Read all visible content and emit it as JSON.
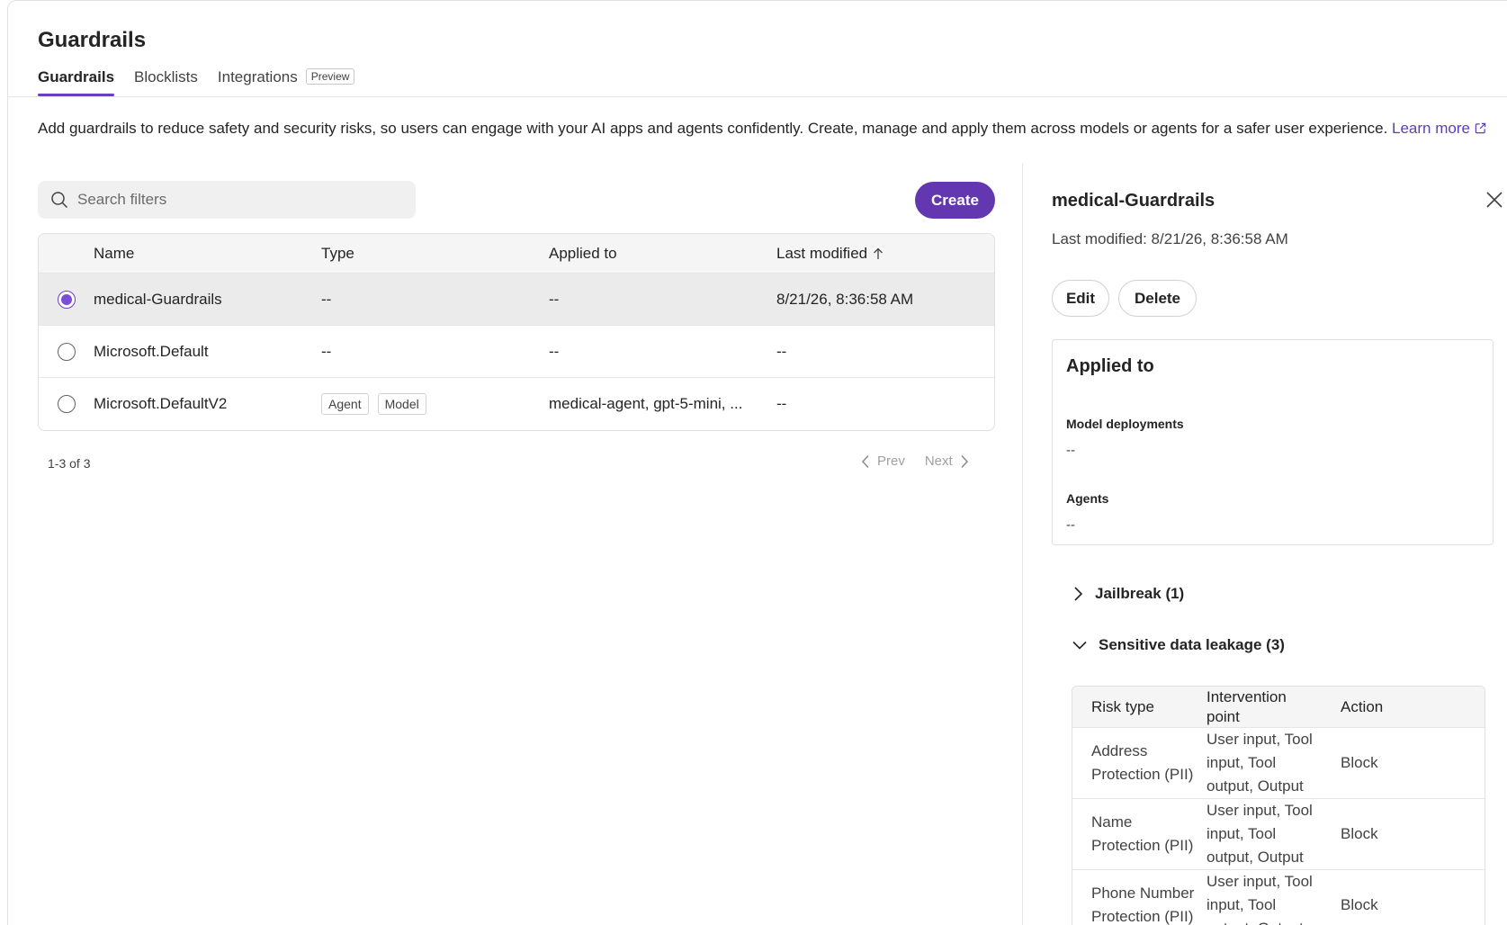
{
  "page": {
    "title": "Guardrails",
    "tabs": [
      {
        "label": "Guardrails"
      },
      {
        "label": "Blocklists"
      },
      {
        "label": "Integrations",
        "badge": "Preview"
      }
    ],
    "intro_text": "Add guardrails to reduce safety and security risks, so users can engage with your AI apps and agents confidently. Create, manage and apply them across models or agents for a safer user experience. ",
    "learn_more": "Learn more"
  },
  "toolbar": {
    "search_placeholder": "Search filters",
    "create_label": "Create"
  },
  "table": {
    "headers": {
      "name": "Name",
      "type": "Type",
      "applied": "Applied to",
      "modified": "Last modified"
    },
    "rows": [
      {
        "name": "medical-Guardrails",
        "type": "--",
        "applied": "--",
        "modified": "8/21/26, 8:36:58 AM",
        "selected": true
      },
      {
        "name": "Microsoft.Default",
        "type": "--",
        "applied": "--",
        "modified": "--",
        "selected": false
      },
      {
        "name": "Microsoft.DefaultV2",
        "tags": [
          "Agent",
          "Model"
        ],
        "applied": "medical-agent, gpt-5-mini, ...",
        "modified": "--",
        "selected": false
      }
    ]
  },
  "pagination": {
    "count": "1-3 of 3",
    "prev": "Prev",
    "next": "Next"
  },
  "panel": {
    "title": "medical-Guardrails",
    "last_modified": "Last modified: 8/21/26, 8:36:58 AM",
    "edit_label": "Edit",
    "delete_label": "Delete",
    "applied": {
      "title": "Applied to",
      "model_label": "Model deployments",
      "model_value": "--",
      "agents_label": "Agents",
      "agents_value": "--"
    },
    "sections": [
      {
        "label": "Jailbreak (1)",
        "expanded": false
      },
      {
        "label": "Sensitive data leakage (3)",
        "expanded": true
      }
    ],
    "risk_table": {
      "headers": {
        "risk": "Risk type",
        "intervention_1": "Intervention",
        "intervention_2": "point",
        "action": "Action"
      },
      "rows": [
        {
          "risk_1": "Address",
          "risk_2": "Protection (PII)",
          "point_1": "User input, Tool",
          "point_2": "input, Tool",
          "point_3": "output, Output",
          "action": "Block"
        },
        {
          "risk_1": "Name",
          "risk_2": "Protection (PII)",
          "point_1": "User input, Tool",
          "point_2": "input, Tool",
          "point_3": "output, Output",
          "action": "Block"
        },
        {
          "risk_1": "Phone Number",
          "risk_2": "Protection (PII)",
          "point_1": "User input, Tool",
          "point_2": "input, Tool",
          "point_3": "output, Output",
          "action": "Block"
        }
      ]
    }
  },
  "colors": {
    "accent": "#6237b0",
    "link": "#5b3fb5",
    "selected_row": "#ebebeb"
  }
}
